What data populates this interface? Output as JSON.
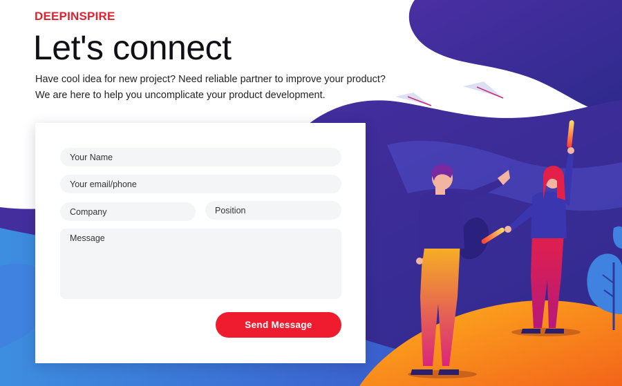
{
  "brand": {
    "name": "DEEPINSPIRE"
  },
  "hero": {
    "title": "Let's connect",
    "intro_line1": "Have cool idea for new project? Need reliable partner to improve your product?",
    "intro_line2": "We are here to help you uncomplicate your product development."
  },
  "form": {
    "name_placeholder": "Your Name",
    "email_placeholder": "Your email/phone",
    "company_placeholder": "Company",
    "position_placeholder": "Position",
    "message_placeholder": "Message",
    "submit_label": "Send Message"
  },
  "colors": {
    "brand_red": "#e3202f",
    "button_red": "#ee1c2e",
    "indigo": "#3b2f9a",
    "blue": "#3d6fd6",
    "orange": "#f7941d"
  },
  "illustration": {
    "icons": [
      "paper-plane-icon",
      "paper-plane-icon",
      "glow-stick-icon",
      "tree-icon"
    ]
  }
}
